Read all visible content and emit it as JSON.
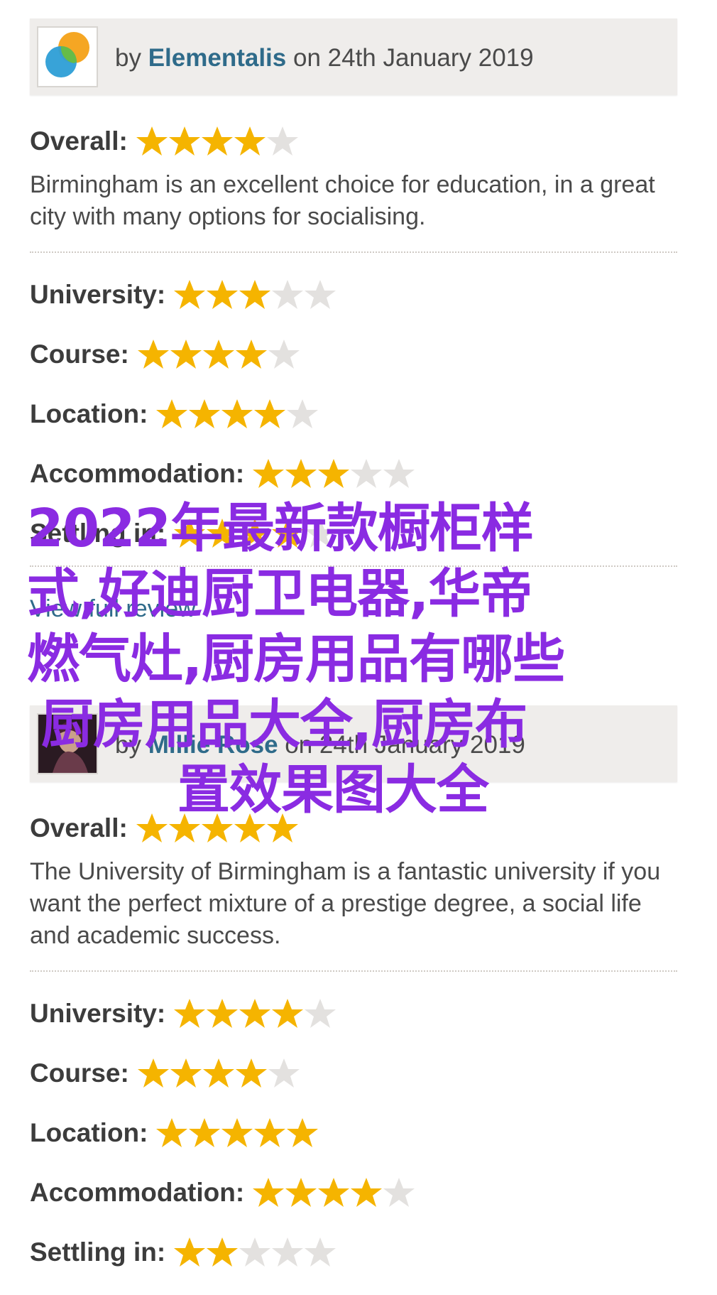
{
  "reviews": [
    {
      "by": "by",
      "author": "Elementalis",
      "date_text": "on 24th January 2019",
      "overall_label": "Overall:",
      "overall_rating": 4,
      "text": "Birmingham is an excellent choice for education, in a great city with many options for socialising.",
      "ratings": [
        {
          "label": "University:",
          "rating": 3
        },
        {
          "label": "Course:",
          "rating": 4
        },
        {
          "label": "Location:",
          "rating": 4
        },
        {
          "label": "Accommodation:",
          "rating": 3
        },
        {
          "label": "Settling in:",
          "rating": 4
        }
      ],
      "link": "View full review"
    },
    {
      "by": "by",
      "author": "Millie Rose",
      "date_text": "on 24th January 2019",
      "overall_label": "Overall:",
      "overall_rating": 5,
      "text": "The University of Birmingham is a fantastic university if you want the perfect mixture of a prestige degree, a social life and academic success.",
      "ratings": [
        {
          "label": "University:",
          "rating": 4
        },
        {
          "label": "Course:",
          "rating": 4
        },
        {
          "label": "Location:",
          "rating": 5
        },
        {
          "label": "Accommodation:",
          "rating": 4
        },
        {
          "label": "Settling in:",
          "rating": 2
        }
      ]
    }
  ],
  "overlay": {
    "lines": [
      "2022年最新款橱柜样",
      "式,好迪厨卫电器,华帝",
      "燃气灶,厨房用品有哪些",
      "厨房用品大全,厨房布",
      "置效果图大全"
    ]
  },
  "colors": {
    "star_on": "#f5b400",
    "star_off": "#e3e1df",
    "accent": "#2f6b8a",
    "overlay": "#8a2be2"
  }
}
